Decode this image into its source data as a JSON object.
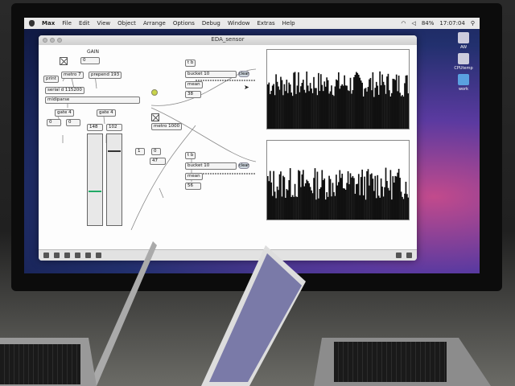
{
  "menubar": {
    "app": "Max",
    "items": [
      "File",
      "Edit",
      "View",
      "Object",
      "Arrange",
      "Options",
      "Debug",
      "Window",
      "Extras",
      "Help"
    ],
    "battery": "84%",
    "time": "17:07:04"
  },
  "desktop": {
    "icons": [
      {
        "label": "AW"
      },
      {
        "label": "CPUtemp"
      },
      {
        "label": "work"
      }
    ]
  },
  "window": {
    "title": "EDA_sensor"
  },
  "patch": {
    "gain_label": "GAIN",
    "objects": {
      "number_top": "0",
      "print": "print",
      "metro_7": "metro 7",
      "prepend": "prepend 193",
      "serial": "serial d 115200",
      "midiparse": "midiparse",
      "gate_left": "gate 4",
      "gate_right": "gate 4",
      "num_a": "0",
      "num_b": "0",
      "slider_val_left": "148",
      "slider_val_right": "102",
      "metro_1000": "metro 1000",
      "t_b_1": "t b",
      "bucket_1": "bucket 10",
      "mean_1": "mean",
      "mean_1_val": "38",
      "clear_1": "clear",
      "t_b_2": "t b",
      "bucket_2": "bucket 10",
      "mean_2": "mean",
      "mean_2_val": "56",
      "clear_2": "clear",
      "num_c": "1",
      "num_d": "0",
      "num_e": "47"
    }
  },
  "colors": {
    "screen_bg": "#22306e",
    "accent_green": "#2a6",
    "led": "#c8d44a"
  }
}
